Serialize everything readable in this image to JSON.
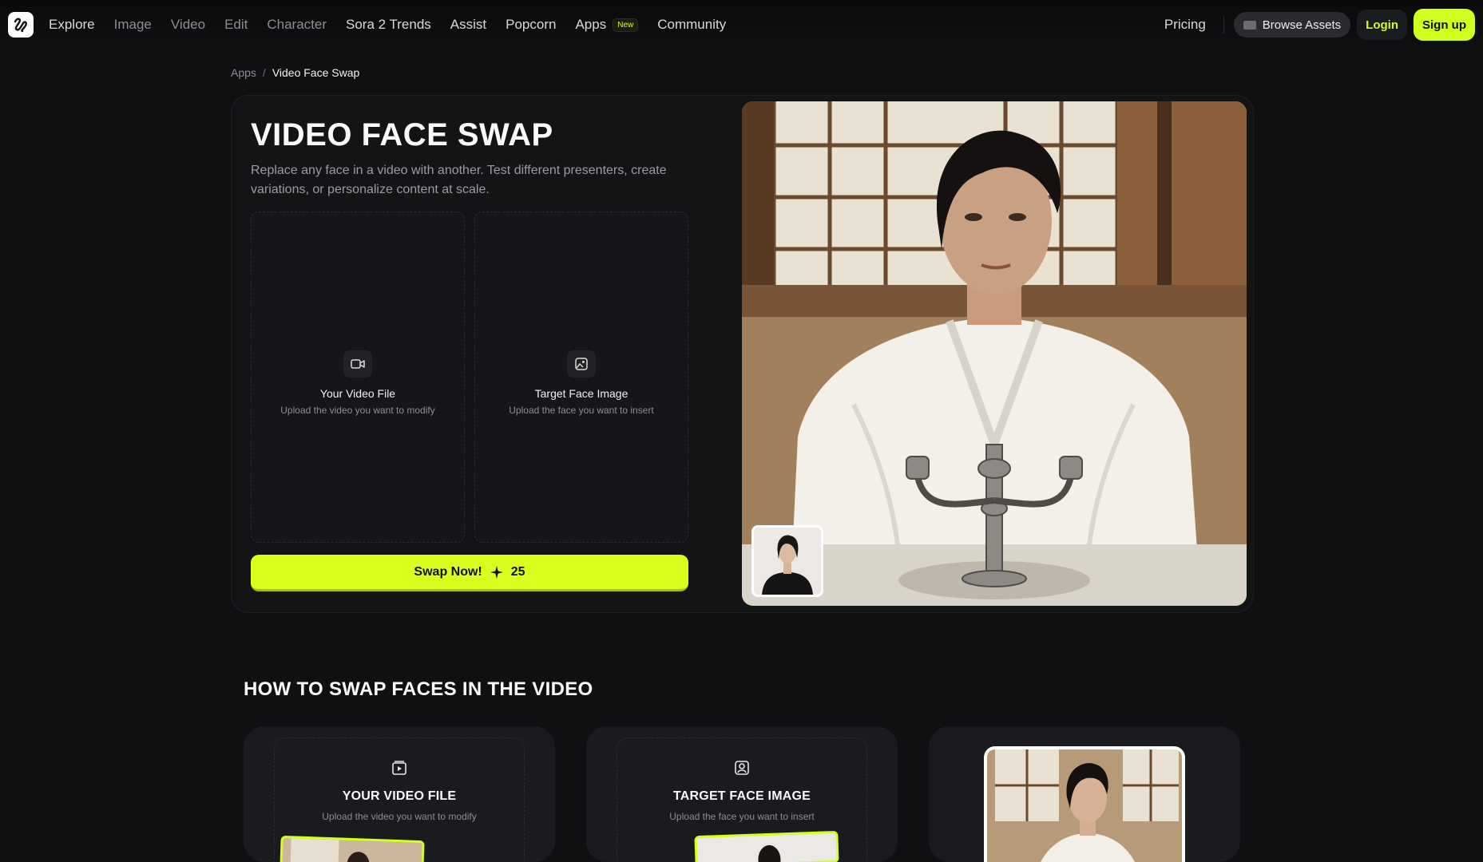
{
  "nav": {
    "items": [
      {
        "label": "Explore",
        "dim": false
      },
      {
        "label": "Image",
        "dim": true
      },
      {
        "label": "Video",
        "dim": true
      },
      {
        "label": "Edit",
        "dim": true
      },
      {
        "label": "Character",
        "dim": true
      },
      {
        "label": "Sora 2 Trends",
        "dim": false
      },
      {
        "label": "Assist",
        "dim": false
      },
      {
        "label": "Popcorn",
        "dim": false
      },
      {
        "label": "Apps",
        "dim": false
      },
      {
        "label": "Community",
        "dim": false
      }
    ],
    "apps_badge": "New",
    "pricing": "Pricing",
    "browse_assets": "Browse Assets",
    "login": "Login",
    "signup": "Sign up"
  },
  "breadcrumb": {
    "parent": "Apps",
    "separator": "/",
    "current": "Video Face Swap"
  },
  "hero": {
    "title": "VIDEO FACE SWAP",
    "description": "Replace any face in a video with another. Test different presenters, create variations, or personalize content at scale.",
    "video_upload": {
      "title": "Your Video File",
      "subtitle": "Upload the video you want to modify",
      "icon": "video-camera-icon"
    },
    "face_upload": {
      "title": "Target Face Image",
      "subtitle": "Upload the face you want to insert",
      "icon": "image-icon"
    },
    "swap_button": "Swap Now!",
    "credits": "25"
  },
  "how_to": {
    "heading": "HOW TO SWAP FACES IN THE VIDEO",
    "cards": [
      {
        "title": "YOUR VIDEO FILE",
        "subtitle": "Upload the video you want to modify",
        "icon": "video-file-icon"
      },
      {
        "title": "TARGET FACE IMAGE",
        "subtitle": "Upload the face you want to insert",
        "icon": "portrait-icon"
      }
    ]
  },
  "colors": {
    "accent": "#d2ff1e",
    "background": "#0f1012",
    "card": "#131416"
  }
}
